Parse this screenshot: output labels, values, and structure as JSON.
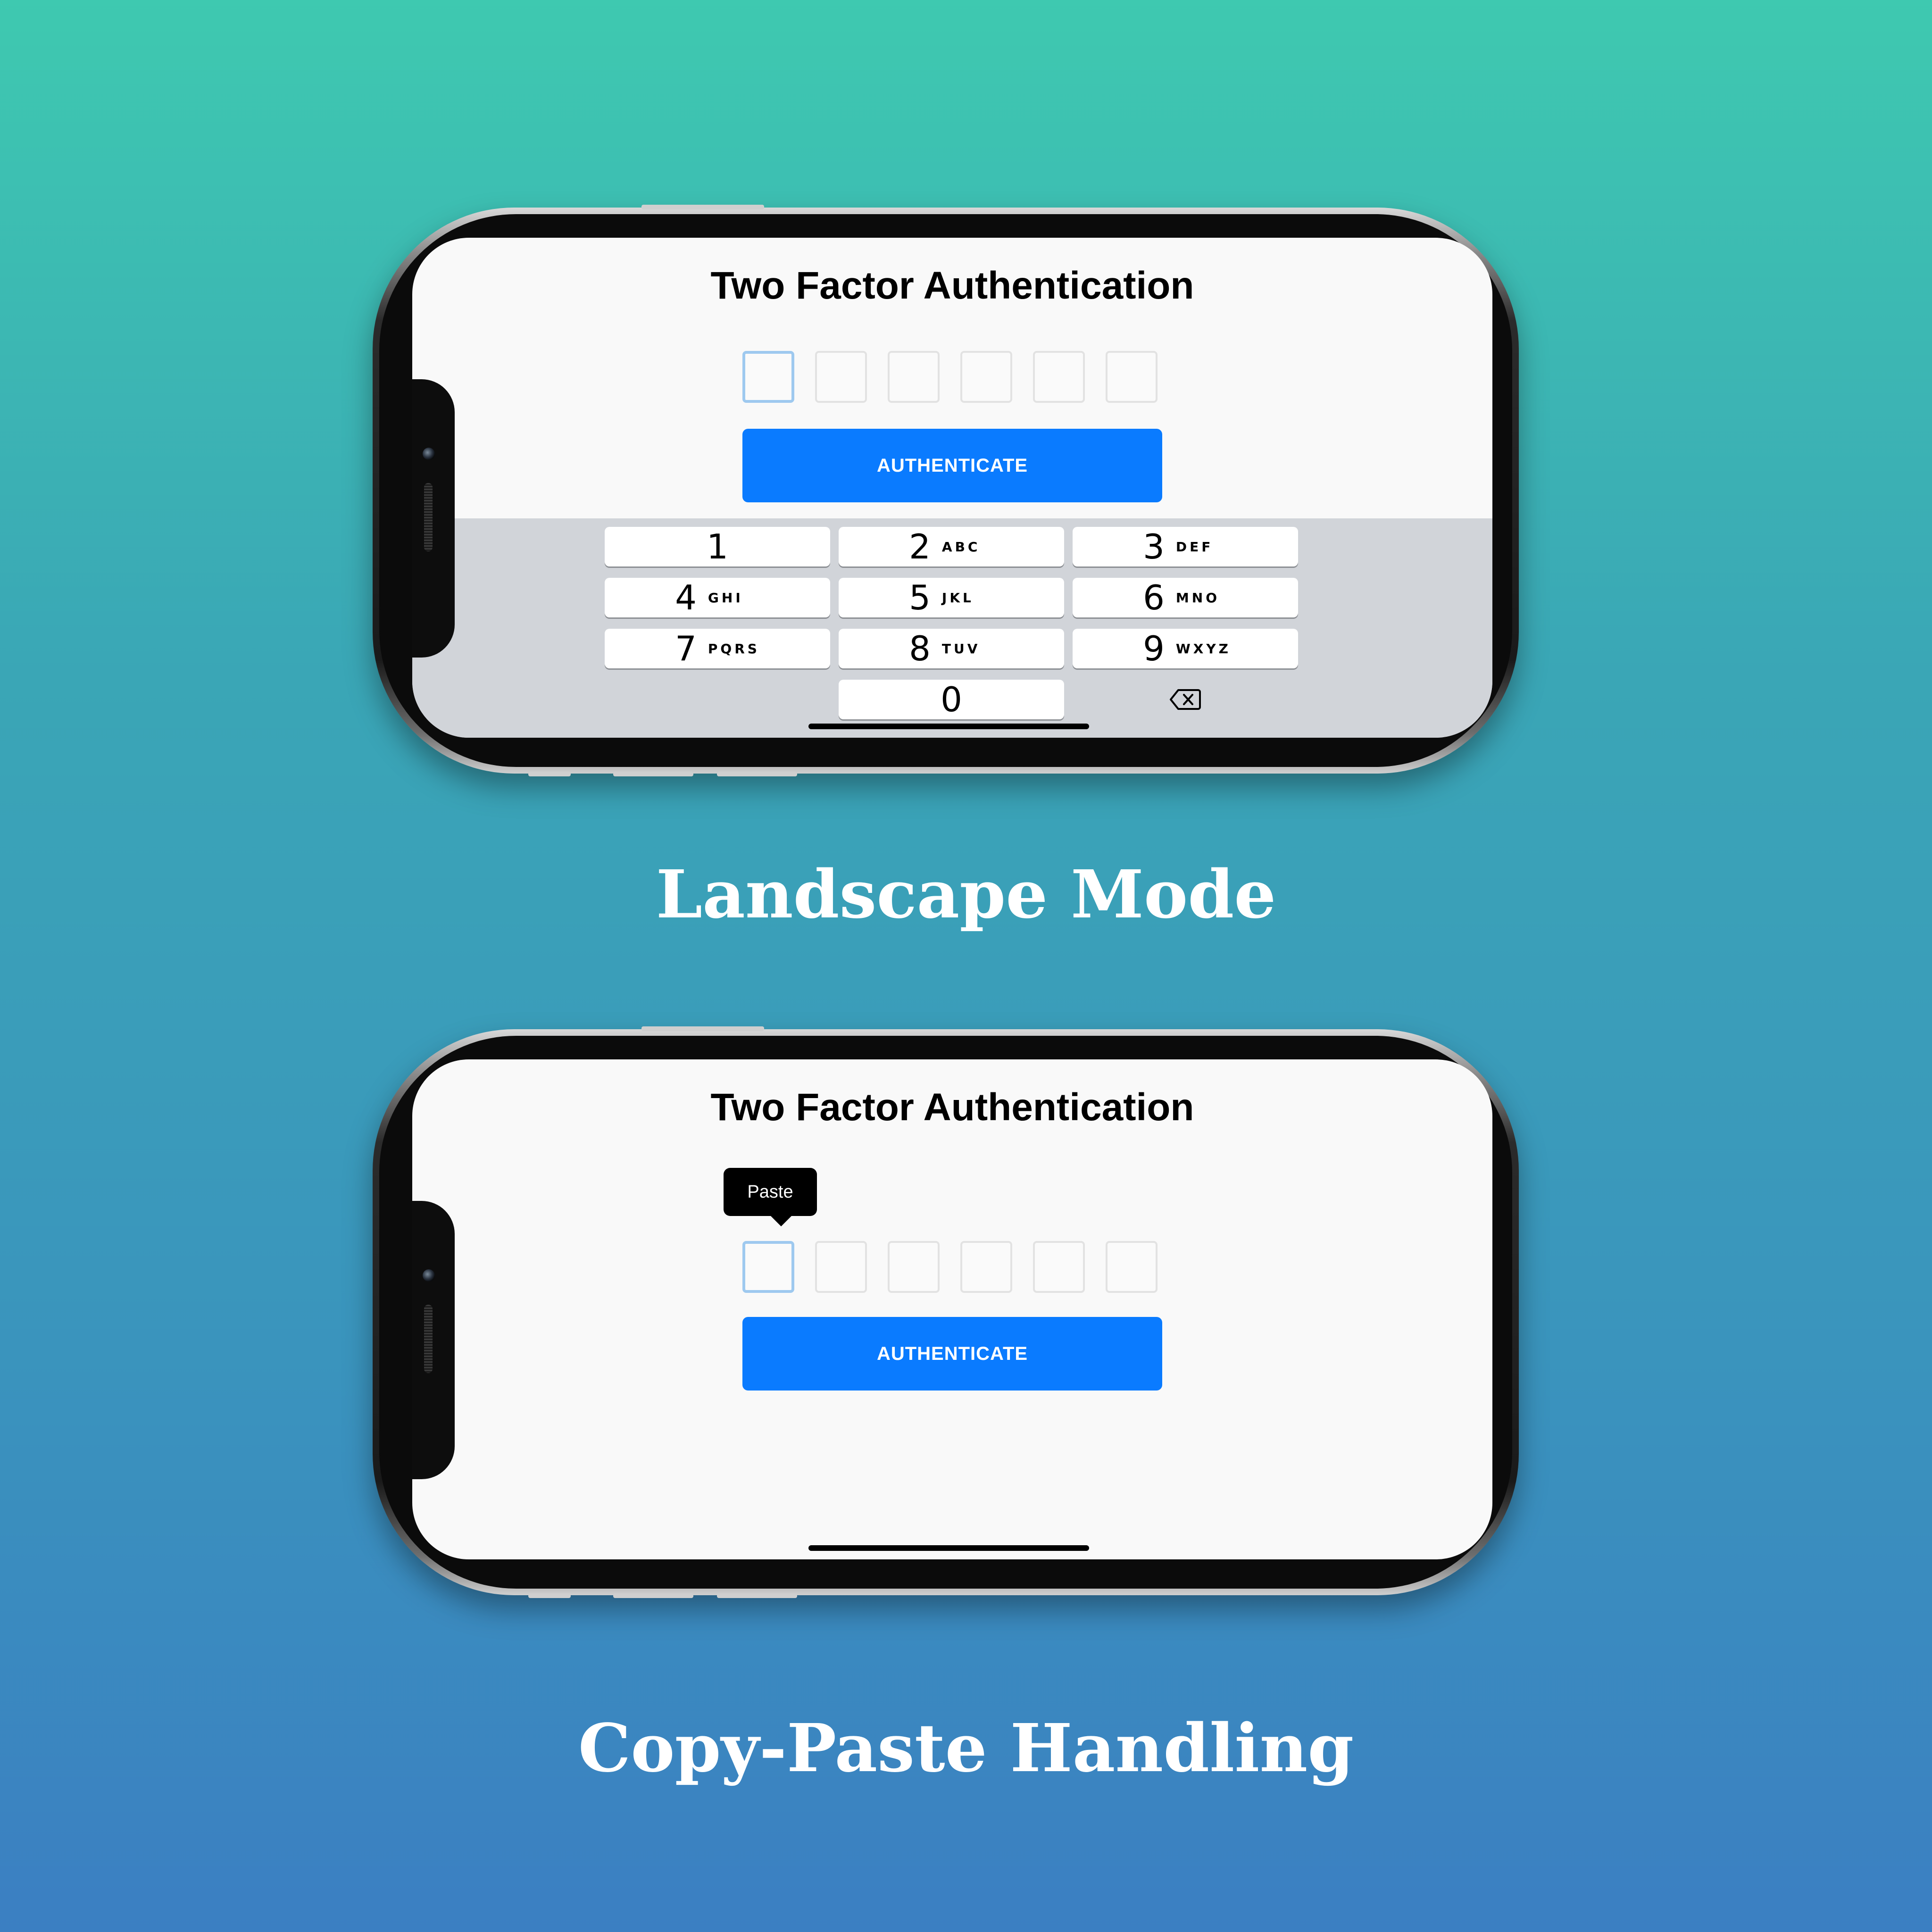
{
  "phones": [
    {
      "title": "Two Factor Authentication",
      "button_label": "AUTHENTICATE",
      "code_digits": [
        "",
        "",
        "",
        "",
        "",
        ""
      ],
      "keyboard": {
        "keys": [
          {
            "num": "1",
            "letters": ""
          },
          {
            "num": "2",
            "letters": "ABC"
          },
          {
            "num": "3",
            "letters": "DEF"
          },
          {
            "num": "4",
            "letters": "GHI"
          },
          {
            "num": "5",
            "letters": "JKL"
          },
          {
            "num": "6",
            "letters": "MNO"
          },
          {
            "num": "7",
            "letters": "PQRS"
          },
          {
            "num": "8",
            "letters": "TUV"
          },
          {
            "num": "9",
            "letters": "WXYZ"
          },
          {
            "num": "0",
            "letters": ""
          }
        ],
        "delete_icon": "backspace-icon"
      }
    },
    {
      "title": "Two Factor Authentication",
      "button_label": "AUTHENTICATE",
      "code_digits": [
        "",
        "",
        "",
        "",
        "",
        ""
      ],
      "tooltip": "Paste"
    }
  ],
  "captions": {
    "landscape": "Landscape Mode",
    "copy_paste": "Copy-Paste Handling"
  },
  "colors": {
    "accent": "#0a7bff",
    "focus_border": "#9ec9ef",
    "keyboard_bg": "#d1d4d9"
  }
}
